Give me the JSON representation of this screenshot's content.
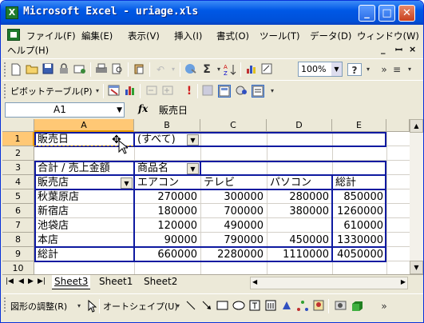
{
  "window": {
    "title": "Microsoft Excel - uriage.xls",
    "icon_letter": "X",
    "minimize": "_",
    "maximize": "□",
    "close": "✕"
  },
  "menu": {
    "items": [
      "ファイル(F)",
      "編集(E)",
      "表示(V)",
      "挿入(I)",
      "書式(O)",
      "ツール(T)",
      "データ(D)",
      "ウィンドウ(W)",
      "ヘルプ(H)"
    ],
    "doc_controls": {
      "minimize": "_",
      "restore": "ꟷ",
      "close": "×"
    }
  },
  "toolbar1": {
    "icons": [
      "new-icon",
      "open-icon",
      "save-icon",
      "permission-icon",
      "mail-icon",
      "print-icon",
      "print-preview-icon",
      "paste-icon",
      "undo-icon",
      "hyperlink-icon",
      "autosum-icon",
      "sort-ascending-icon",
      "chart-wizard-icon",
      "help-icon",
      "more-icon",
      "options-icon"
    ],
    "autosum_label": "Σ",
    "zoom_value": "100%",
    "help_label": "?"
  },
  "toolbar2": {
    "pivot_label": "ピボットテーブル(P)",
    "icons": [
      "pivot-format-icon",
      "pivot-chart-icon",
      "hide-detail-icon",
      "show-detail-icon",
      "refresh-icon",
      "include-hidden-icon",
      "always-display-icon",
      "field-settings-icon",
      "field-list-icon"
    ]
  },
  "formula": {
    "name_box": "A1",
    "fx": "fx",
    "content": "販売日"
  },
  "columns": [
    {
      "label": "A"
    },
    {
      "label": "B"
    },
    {
      "label": "C"
    },
    {
      "label": "D"
    },
    {
      "label": "E"
    }
  ],
  "rows": [
    "1",
    "2",
    "3",
    "4",
    "5",
    "6",
    "7",
    "8",
    "9",
    "10"
  ],
  "sheet": {
    "r1": {
      "a": "販売日",
      "b": "(すべて)"
    },
    "r3": {
      "a": "合計 / 売上金額",
      "b": "商品名"
    },
    "r4": {
      "a": "販売店",
      "b": "エアコン",
      "c": "テレビ",
      "d": "パソコン",
      "e": "総計"
    },
    "r5": {
      "a": "秋葉原店",
      "b": "270000",
      "c": "300000",
      "d": "280000",
      "e": "850000"
    },
    "r6": {
      "a": "新宿店",
      "b": "180000",
      "c": "700000",
      "d": "380000",
      "e": "1260000"
    },
    "r7": {
      "a": "池袋店",
      "b": "120000",
      "c": "490000",
      "d": "",
      "e": "610000"
    },
    "r8": {
      "a": "本店",
      "b": "90000",
      "c": "790000",
      "d": "450000",
      "e": "1330000"
    },
    "r9": {
      "a": "総計",
      "b": "660000",
      "c": "2280000",
      "d": "1110000",
      "e": "4050000"
    }
  },
  "tabs": {
    "sheet3": "Sheet3",
    "sheet1": "Sheet1",
    "sheet2": "Sheet2"
  },
  "drawing": {
    "adjust_label": "図形の調整(R)",
    "autoshape_label": "オートシェイプ(U)"
  },
  "colors": {
    "title_bar": "#0058e6",
    "selected_header": "#ffc875",
    "pivot_border": "#0e1aa0",
    "excel_green": "#1f7a2e"
  }
}
